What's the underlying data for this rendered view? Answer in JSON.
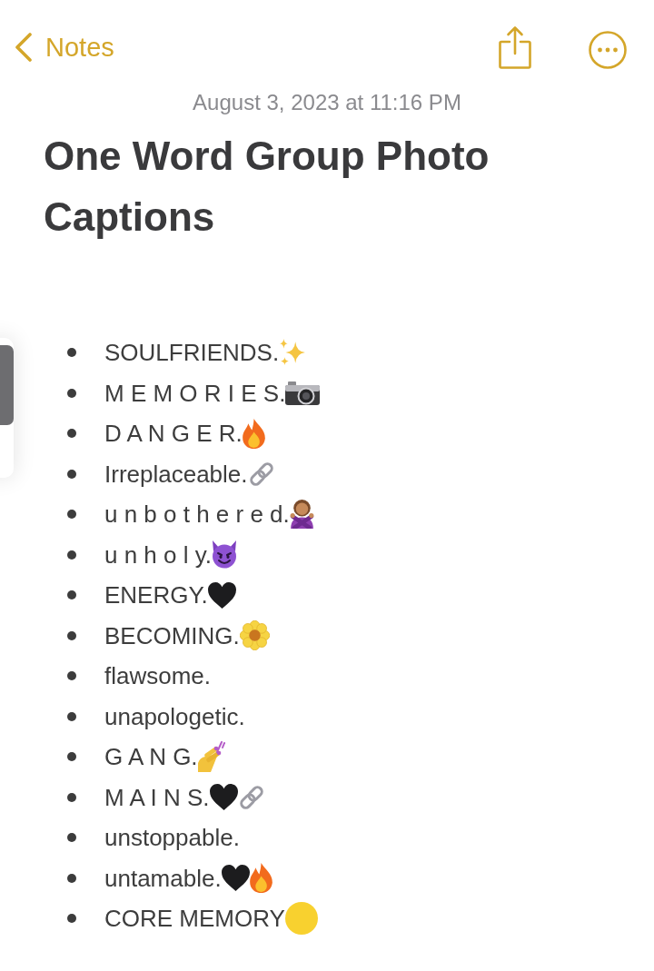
{
  "nav": {
    "back_label": "Notes"
  },
  "note": {
    "date": "August 3, 2023 at 11:16 PM",
    "title": "One Word Group Photo Captions",
    "items": [
      {
        "text": "SOULFRIENDS.",
        "icons": [
          {
            "kind": "sparkles"
          }
        ]
      },
      {
        "text": "M E M O R I E S.",
        "icons": [
          {
            "kind": "camera"
          }
        ]
      },
      {
        "text": "D A N G E R.",
        "icons": [
          {
            "kind": "fire"
          }
        ]
      },
      {
        "text": "Irreplaceable.",
        "icons": [
          {
            "kind": "link"
          }
        ]
      },
      {
        "text": "u n b o t h e r e d.",
        "icons": [
          {
            "kind": "person_no"
          }
        ]
      },
      {
        "text": "u n h o l y.",
        "icons": [
          {
            "kind": "devil"
          }
        ]
      },
      {
        "text": "ENERGY.",
        "icons": [
          {
            "kind": "heart"
          }
        ]
      },
      {
        "text": "BECOMING.",
        "icons": [
          {
            "kind": "blossom"
          }
        ]
      },
      {
        "text": "flawsome."
      },
      {
        "text": "unapologetic."
      },
      {
        "text": "G A N G.",
        "icons": [
          {
            "kind": "nail_polish"
          }
        ]
      },
      {
        "text": "M A I N S.",
        "icons": [
          {
            "kind": "heart"
          },
          {
            "kind": "link"
          }
        ]
      },
      {
        "text": "unstoppable."
      },
      {
        "text": "untamable.",
        "icons": [
          {
            "kind": "heart"
          },
          {
            "kind": "fire"
          }
        ]
      },
      {
        "text": "CORE MEMORY",
        "icons": [
          {
            "kind": "circle"
          }
        ]
      }
    ]
  }
}
